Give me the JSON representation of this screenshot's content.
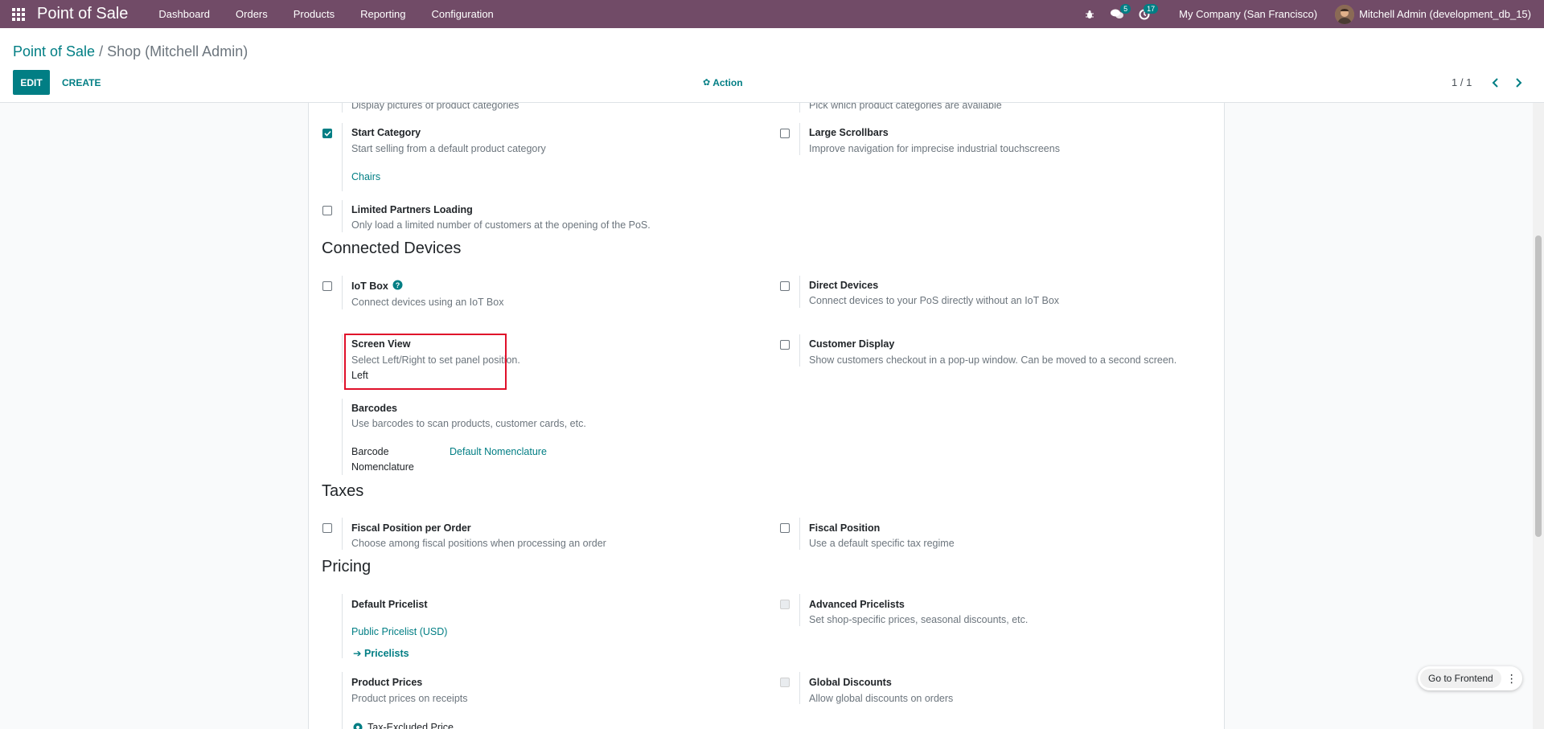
{
  "navbar": {
    "app_name": "Point of Sale",
    "menu": [
      "Dashboard",
      "Orders",
      "Products",
      "Reporting",
      "Configuration"
    ],
    "messages_count": "5",
    "activities_count": "17",
    "company": "My Company (San Francisco)",
    "user": "Mitchell Admin (development_db_15)",
    "bg_color": "#714b67"
  },
  "control": {
    "breadcrumb_parent": "Point of Sale",
    "breadcrumb_sep": "/",
    "breadcrumb_current": "Shop (Mitchell Admin)",
    "edit_label": "EDIT",
    "create_label": "CREATE",
    "action_label": "Action",
    "pager": "1 / 1"
  },
  "settings": {
    "partial_desc_left": "Display pictures of product categories",
    "partial_desc_right": "Pick which product categories are available",
    "start_category": {
      "label": "Start Category",
      "desc": "Start selling from a default product category",
      "value": "Chairs",
      "checked": true
    },
    "large_scrollbars": {
      "label": "Large Scrollbars",
      "desc": "Improve navigation for imprecise industrial touchscreens",
      "checked": false
    },
    "limited_partners": {
      "label": "Limited Partners Loading",
      "desc": "Only load a limited number of customers at the opening of the PoS.",
      "checked": false
    },
    "connected_devices_title": "Connected Devices",
    "iot_box": {
      "label": "IoT Box",
      "desc": "Connect devices using an IoT Box",
      "checked": false
    },
    "direct_devices": {
      "label": "Direct Devices",
      "desc": "Connect devices to your PoS directly without an IoT Box",
      "checked": false
    },
    "screen_view": {
      "label": "Screen View",
      "desc": "Select Left/Right to set panel position.",
      "value": "Left"
    },
    "customer_display": {
      "label": "Customer Display",
      "desc": "Show customers checkout in a pop-up window. Can be moved to a second screen.",
      "checked": false
    },
    "barcodes": {
      "label": "Barcodes",
      "desc": "Use barcodes to scan products, customer cards, etc.",
      "field_label_1": "Barcode",
      "field_label_2": "Nomenclature",
      "value": "Default Nomenclature"
    },
    "taxes_title": "Taxes",
    "fiscal_per_order": {
      "label": "Fiscal Position per Order",
      "desc": "Choose among fiscal positions when processing an order",
      "checked": false
    },
    "fiscal_position": {
      "label": "Fiscal Position",
      "desc": "Use a default specific tax regime",
      "checked": false
    },
    "pricing_title": "Pricing",
    "default_pricelist": {
      "label": "Default Pricelist",
      "value": "Public Pricelist (USD)",
      "link": "Pricelists"
    },
    "advanced_pricelists": {
      "label": "Advanced Pricelists",
      "desc": "Set shop-specific prices, seasonal discounts, etc."
    },
    "product_prices": {
      "label": "Product Prices",
      "desc": "Product prices on receipts",
      "option": "Tax-Excluded Price"
    },
    "global_discounts": {
      "label": "Global Discounts",
      "desc": "Allow global discounts on orders"
    }
  },
  "frontend": {
    "label": "Go to Frontend"
  }
}
